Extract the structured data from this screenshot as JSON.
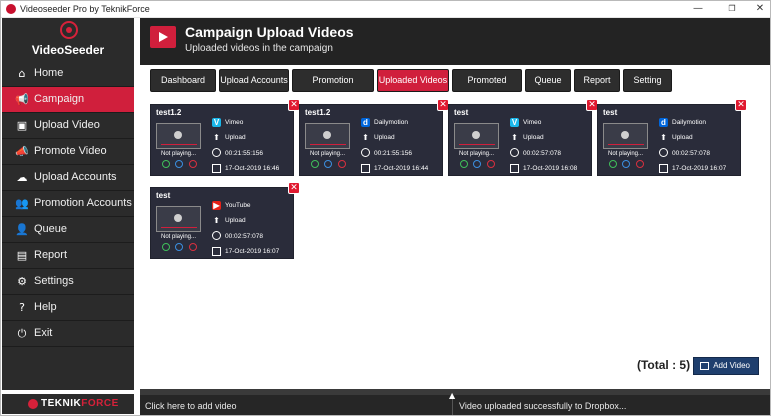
{
  "window": {
    "title": "Videoseeder Pro by TeknikForce",
    "min_glyph": "—",
    "max_glyph": "❐",
    "close_glyph": "✕"
  },
  "sidebar": {
    "logo_text": "VideoSeeder",
    "items": [
      {
        "label": "Home",
        "icon": "home-icon",
        "glyph": "⌂",
        "active": false
      },
      {
        "label": "Campaign",
        "icon": "megaphone-icon",
        "glyph": "📢",
        "active": true
      },
      {
        "label": "Upload Video",
        "icon": "upload-video-icon",
        "glyph": "▣",
        "active": false
      },
      {
        "label": "Promote Video",
        "icon": "promote-icon",
        "glyph": "📣",
        "active": false
      },
      {
        "label": "Upload Accounts",
        "icon": "accounts-icon",
        "glyph": "☁",
        "active": false
      },
      {
        "label": "Promotion Accounts",
        "icon": "users-icon",
        "glyph": "👥",
        "active": false
      },
      {
        "label": "Queue",
        "icon": "queue-icon",
        "glyph": "👤",
        "active": false
      },
      {
        "label": "Report",
        "icon": "report-icon",
        "glyph": "▤",
        "active": false
      },
      {
        "label": "Settings",
        "icon": "gear-icon",
        "glyph": "⚙",
        "active": false
      },
      {
        "label": "Help",
        "icon": "help-icon",
        "glyph": "?",
        "active": false
      },
      {
        "label": "Exit",
        "icon": "exit-icon",
        "glyph": "⏻",
        "active": false
      }
    ],
    "brand_left": "TEKNIK",
    "brand_right": "FORCE"
  },
  "header": {
    "title": "Campaign Upload Videos",
    "subtitle": "Uploaded videos in the campaign"
  },
  "tabs": [
    {
      "label": "Dashboard",
      "active": false
    },
    {
      "label": "Upload Accounts",
      "active": false
    },
    {
      "label": "Promotion Accounts",
      "active": false
    },
    {
      "label": "Uploaded Videos",
      "active": true
    },
    {
      "label": "Promoted Videos",
      "active": false
    },
    {
      "label": "Queue",
      "active": false
    },
    {
      "label": "Report",
      "active": false
    },
    {
      "label": "Setting",
      "active": false
    }
  ],
  "cards": [
    {
      "title": "test1.2",
      "platform": "Vimeo",
      "platform_glyph": "V",
      "platform_color": "#1ab7ea",
      "action": "Upload",
      "duration": "00:21:55:156",
      "date": "17-Oct-2019 16:46",
      "status": "Not playing..."
    },
    {
      "title": "test1.2",
      "platform": "Dailymotion",
      "platform_glyph": "d",
      "platform_color": "#0066dc",
      "action": "Upload",
      "duration": "00:21:55:156",
      "date": "17-Oct-2019 16:44",
      "status": "Not playing..."
    },
    {
      "title": "test",
      "platform": "Vimeo",
      "platform_glyph": "V",
      "platform_color": "#1ab7ea",
      "action": "Upload",
      "duration": "00:02:57:078",
      "date": "17-Oct-2019 16:08",
      "status": "Not playing..."
    },
    {
      "title": "test",
      "platform": "Dailymotion",
      "platform_glyph": "d",
      "platform_color": "#0066dc",
      "action": "Upload",
      "duration": "00:02:57:078",
      "date": "17-Oct-2019 16:07",
      "status": "Not playing..."
    },
    {
      "title": "test",
      "platform": "YouTube",
      "platform_glyph": "▶",
      "platform_color": "#e62117",
      "action": "Upload",
      "duration": "00:02:57:078",
      "date": "17-Oct-2019 16:07",
      "status": "Not playing..."
    }
  ],
  "close_glyph": "✕",
  "total_label": "(Total : 5)",
  "add_video_label": "Add Video",
  "statusbar": {
    "left": "Click here to add video",
    "right": "Video uploaded successfully to Dropbox...",
    "arrow": "▲"
  },
  "colors": {
    "accent": "#d01f3c",
    "sidebar_bg": "#2b2b2b",
    "card_bg": "#2a2c3a",
    "add_button": "#1f3f6e"
  }
}
